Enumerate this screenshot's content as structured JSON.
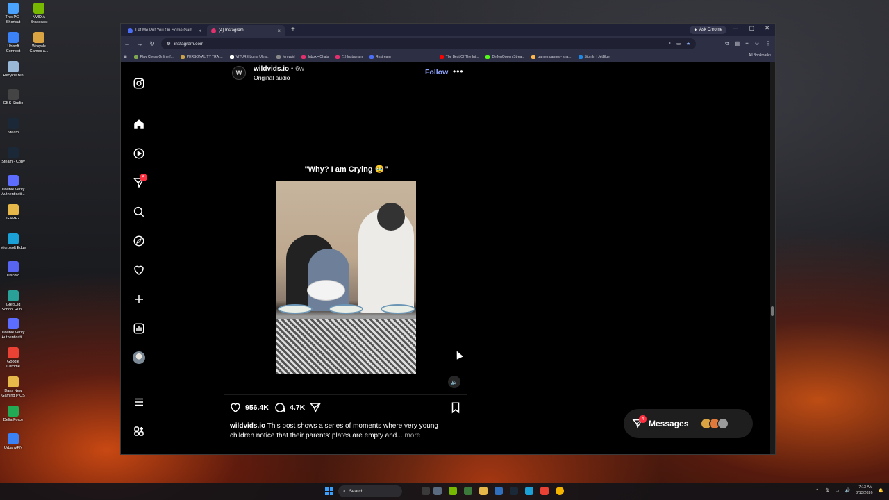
{
  "desktop": {
    "icons": [
      {
        "label": "This PC - Shortcut",
        "color": "#4aa3ff"
      },
      {
        "label": "NVIDIA Broadcast",
        "color": "#76b900"
      },
      {
        "label": "Ubisoft Connect",
        "color": "#3b82f6"
      },
      {
        "label": "Wroyals Games a...",
        "color": "#d9a441"
      },
      {
        "label": "Recycle Bin",
        "color": "#9ab8d8"
      },
      {
        "label": "OBS Studio",
        "color": "#444"
      },
      {
        "label": "Steam",
        "color": "#1b2838"
      },
      {
        "label": "Steam - Copy",
        "color": "#1b2838"
      },
      {
        "label": "Double Verify Authenticati...",
        "color": "#5b6cff"
      },
      {
        "label": "GAMEZ",
        "color": "#e6b84a"
      },
      {
        "label": "Microsoft Edge",
        "color": "#1aa1d8"
      },
      {
        "label": "Discord",
        "color": "#5865f2"
      },
      {
        "label": "GregOld School Run...",
        "color": "#2aa198"
      },
      {
        "label": "Double Verify Authenticati...",
        "color": "#5b6cff"
      },
      {
        "label": "Google Chrome",
        "color": "#e94235"
      },
      {
        "label": "Dans New Gaming PICS",
        "color": "#e6b84a"
      },
      {
        "label": "Delta Force",
        "color": "#22aa55"
      },
      {
        "label": "UrbanVPN",
        "color": "#3b82f6"
      }
    ]
  },
  "browser": {
    "tabs": [
      {
        "label": "Let Me Put You On Some Gam",
        "favicon_color": "#4c6ef5"
      },
      {
        "label": "(4) Instagram",
        "favicon_color": "#e1306c",
        "active": true
      }
    ],
    "ask_chrome": "Ask Chrome",
    "url": "instagram.com",
    "bookmarks": [
      {
        "label": "Play Chess Online f...",
        "color": "#7fa650"
      },
      {
        "label": "PERSONALITY TRAI...",
        "color": "#caa24a"
      },
      {
        "label": "VITURE Luma Ultra...",
        "color": "#ffffff"
      },
      {
        "label": "fentygirl",
        "color": "#888"
      },
      {
        "label": "Inbox • Chats",
        "color": "#e1306c"
      },
      {
        "label": "(1) Instagram",
        "color": "#e1306c"
      },
      {
        "label": "Restream",
        "color": "#4c6ef5"
      },
      {
        "label": "The Best Of The Int...",
        "color": "#ff0000"
      },
      {
        "label": "DeJenQueen Strea...",
        "color": "#53fc18"
      },
      {
        "label": "games games - sha...",
        "color": "#ffb74d"
      },
      {
        "label": "Sign In | JetBlue",
        "color": "#1e88e5"
      }
    ],
    "all_bookmarks": "All Bookmarks"
  },
  "instagram": {
    "nav_badge": "5",
    "post": {
      "username": "wildvids.io",
      "time": " • 6w",
      "audio": "Original audio",
      "follow": "Follow",
      "more_icon": "•••",
      "avatar_letter": "W",
      "video_caption": "\"Why? I am Crying 🥹\"",
      "likes": "956.4K",
      "comments": "4.7K",
      "caption_user": "wildvids.io",
      "caption_text": " This post shows a series of moments where very young children notice that their parents’ plates are empty and...",
      "caption_more": " more"
    },
    "messages": {
      "label": "Messages",
      "badge": "4",
      "more": "···"
    }
  },
  "taskbar": {
    "search": "Search",
    "time": "7:13 AM",
    "date": "3/13/2026"
  }
}
